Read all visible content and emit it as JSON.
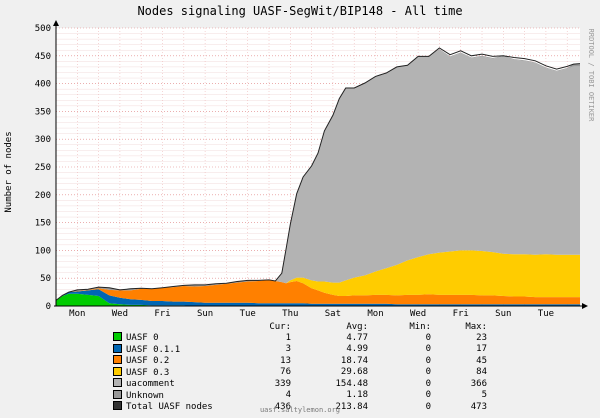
{
  "chart_data": {
    "type": "area",
    "title": "Nodes signaling UASF-SegWit/BIP148 - All time",
    "ylabel": "Number of nodes",
    "xlabel": "",
    "ylim": [
      0,
      500
    ],
    "yticks": [
      0,
      50,
      100,
      150,
      200,
      250,
      300,
      350,
      400,
      450,
      500
    ],
    "grid": true,
    "x_day_labels": [
      "Mon",
      "Wed",
      "Fri",
      "Sun",
      "Tue",
      "Thu",
      "Sat",
      "Mon",
      "Wed",
      "Fri",
      "Sun",
      "Tue"
    ],
    "x_day_label_positions": [
      1,
      3,
      5,
      7,
      9,
      11,
      13,
      15,
      17,
      19,
      21,
      23
    ],
    "x_range": [
      0,
      24.6
    ],
    "x": [
      0,
      0.3,
      0.6,
      1,
      1.5,
      2,
      2.5,
      3,
      3.5,
      4,
      4.5,
      5,
      5.5,
      6,
      6.5,
      7,
      7.5,
      8,
      8.5,
      9,
      9.5,
      10,
      10.3,
      10.6,
      10.8,
      11,
      11.3,
      11.6,
      12,
      12.3,
      12.6,
      13,
      13.3,
      13.6,
      14,
      14.5,
      15,
      15.5,
      16,
      16.5,
      17,
      17.5,
      18,
      18.5,
      19,
      19.5,
      20,
      20.5,
      21,
      21.5,
      22,
      22.5,
      23,
      23.5,
      24,
      24.3,
      24.6
    ],
    "series": [
      {
        "name": "UASF 0",
        "color": "#00cc00",
        "values": [
          10,
          18,
          22,
          22,
          20,
          18,
          5,
          3,
          2,
          2,
          1,
          1,
          1,
          1,
          0,
          0,
          0,
          0,
          0,
          0,
          0,
          0,
          0,
          0,
          0,
          0,
          0,
          0,
          0,
          0,
          0,
          0,
          0,
          0,
          0,
          0,
          0,
          0,
          0,
          0,
          0,
          0,
          0,
          0,
          0,
          0,
          0,
          0,
          0,
          0,
          0,
          0,
          0,
          0,
          0,
          0,
          0
        ]
      },
      {
        "name": "UASF 0.1.1",
        "color": "#0066b3",
        "values": [
          0,
          1,
          3,
          4,
          8,
          12,
          14,
          12,
          10,
          9,
          8,
          8,
          7,
          7,
          7,
          6,
          6,
          6,
          6,
          6,
          5,
          5,
          5,
          5,
          5,
          5,
          5,
          5,
          4,
          4,
          4,
          4,
          4,
          4,
          4,
          4,
          4,
          4,
          3,
          3,
          3,
          3,
          3,
          3,
          3,
          3,
          3,
          3,
          3,
          3,
          3,
          3,
          3,
          3,
          3,
          3,
          3
        ]
      },
      {
        "name": "UASF 0.2",
        "color": "#ff8000",
        "values": [
          0,
          0,
          0,
          1,
          1,
          2,
          10,
          13,
          16,
          20,
          22,
          24,
          26,
          28,
          28,
          30,
          32,
          34,
          36,
          38,
          40,
          42,
          40,
          38,
          36,
          38,
          40,
          36,
          28,
          24,
          20,
          16,
          14,
          14,
          15,
          15,
          16,
          16,
          16,
          17,
          17,
          18,
          17,
          17,
          17,
          17,
          16,
          16,
          15,
          14,
          14,
          13,
          13,
          13,
          13,
          13,
          13
        ]
      },
      {
        "name": "UASF 0.3",
        "color": "#ffcc00",
        "values": [
          0,
          0,
          0,
          0,
          0,
          0,
          0,
          0,
          0,
          0,
          0,
          0,
          0,
          0,
          0,
          0,
          0,
          0,
          0,
          0,
          0,
          0,
          0,
          0,
          0,
          3,
          6,
          10,
          14,
          16,
          20,
          22,
          24,
          28,
          32,
          36,
          42,
          48,
          55,
          62,
          68,
          72,
          76,
          78,
          80,
          80,
          80,
          78,
          76,
          76,
          76,
          76,
          77,
          76,
          76,
          76,
          76
        ]
      },
      {
        "name": "uacomment",
        "color": "#b3b3b3",
        "values": [
          0,
          0,
          0,
          0,
          0,
          0,
          0,
          0,
          0,
          0,
          0,
          0,
          0,
          0,
          0,
          0,
          0,
          0,
          0,
          0,
          0,
          0,
          0,
          15,
          60,
          100,
          150,
          180,
          205,
          230,
          270,
          300,
          330,
          345,
          340,
          345,
          350,
          350,
          355,
          350,
          360,
          355,
          365,
          350,
          355,
          346,
          350,
          348,
          355,
          350,
          348,
          345,
          335,
          330,
          335,
          339,
          339
        ]
      },
      {
        "name": "Unknown",
        "color": "#999999",
        "values": [
          0,
          0,
          0,
          2,
          1,
          2,
          4,
          1,
          3,
          1,
          0,
          0,
          1,
          1,
          3,
          2,
          2,
          1,
          2,
          2,
          1,
          0,
          0,
          1,
          1,
          1,
          1,
          1,
          1,
          1,
          1,
          1,
          1,
          1,
          1,
          1,
          1,
          1,
          1,
          1,
          1,
          1,
          1,
          1,
          1,
          1,
          1,
          1,
          1,
          1,
          1,
          1,
          1,
          1,
          1,
          4,
          4
        ]
      }
    ],
    "total": {
      "name": "Total UASF nodes",
      "values": [
        10,
        19,
        25,
        29,
        30,
        34,
        33,
        29,
        31,
        32,
        31,
        33,
        35,
        37,
        38,
        38,
        40,
        41,
        44,
        46,
        46,
        47,
        45,
        59,
        102,
        147,
        202,
        232,
        252,
        275,
        315,
        343,
        373,
        392,
        392,
        401,
        413,
        419,
        430,
        433,
        449,
        449,
        464,
        452,
        459,
        450,
        453,
        449,
        450,
        447,
        445,
        441,
        432,
        426,
        431,
        435,
        436
      ]
    },
    "legend": {
      "headers": [
        "Cur:",
        "Avg:",
        "Min:",
        "Max:"
      ],
      "rows": [
        {
          "name": "UASF 0",
          "color": "#00cc00",
          "cur": "1",
          "avg": "4.77",
          "min": "0",
          "max": "23"
        },
        {
          "name": "UASF 0.1.1",
          "color": "#0066b3",
          "cur": "3",
          "avg": "4.99",
          "min": "0",
          "max": "17"
        },
        {
          "name": "UASF 0.2",
          "color": "#ff8000",
          "cur": "13",
          "avg": "18.74",
          "min": "0",
          "max": "45"
        },
        {
          "name": "UASF 0.3",
          "color": "#ffcc00",
          "cur": "76",
          "avg": "29.68",
          "min": "0",
          "max": "84"
        },
        {
          "name": "uacomment",
          "color": "#b3b3b3",
          "cur": "339",
          "avg": "154.48",
          "min": "0",
          "max": "366"
        },
        {
          "name": "Unknown",
          "color": "#999999",
          "cur": "4",
          "avg": "1.18",
          "min": "0",
          "max": "5"
        },
        {
          "name": "Total UASF nodes",
          "color": "#333333",
          "cur": "436",
          "avg": "213.84",
          "min": "0",
          "max": "473"
        }
      ]
    },
    "side_label": "RRDTOOL / TOBI OETIKER",
    "footer": "uasf.saltylemon.org"
  }
}
